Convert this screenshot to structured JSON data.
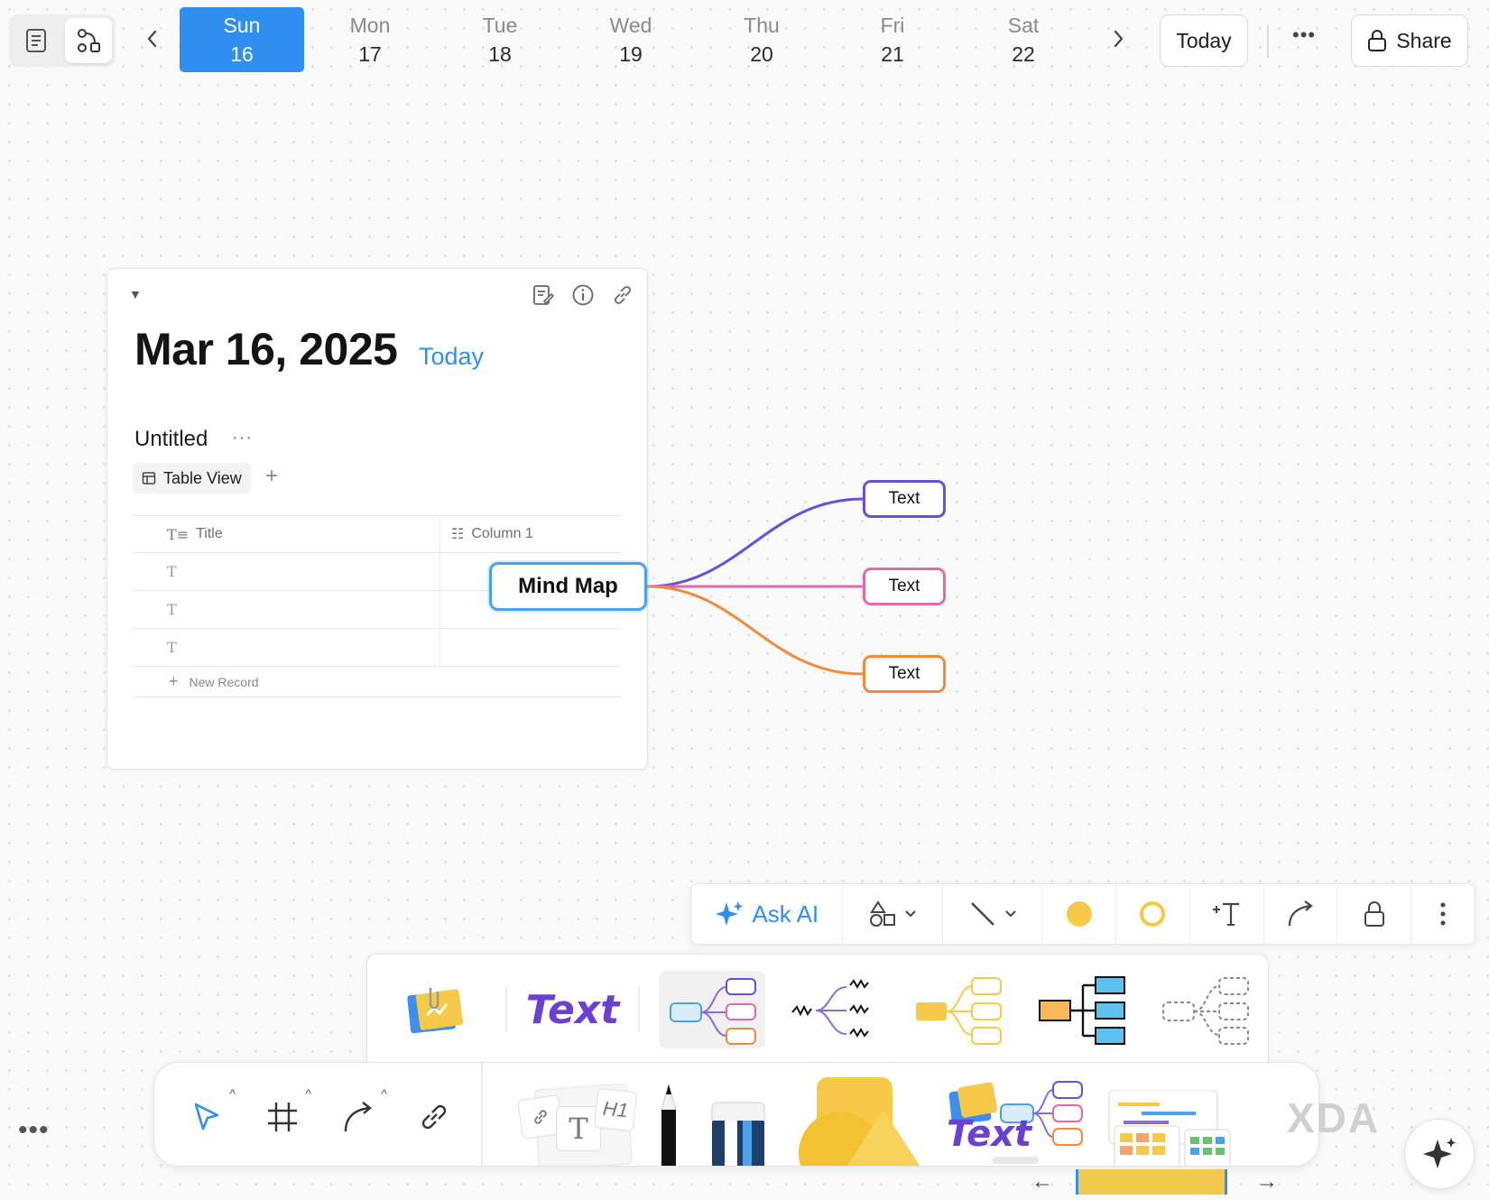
{
  "topbar": {
    "days": [
      {
        "name": "Sun",
        "num": "16"
      },
      {
        "name": "Mon",
        "num": "17"
      },
      {
        "name": "Tue",
        "num": "18"
      },
      {
        "name": "Wed",
        "num": "19"
      },
      {
        "name": "Thu",
        "num": "20"
      },
      {
        "name": "Fri",
        "num": "21"
      },
      {
        "name": "Sat",
        "num": "22"
      }
    ],
    "selected_day": "Sun",
    "today_label": "Today",
    "share_label": "Share",
    "more_label": "•••"
  },
  "journal": {
    "date": "Mar 16, 2025",
    "today_tag": "Today",
    "database": {
      "title": "Untitled",
      "more": "···",
      "view_tab": "Table View",
      "add_view": "+",
      "columns": [
        "Title",
        "Column 1"
      ],
      "row_icon": "T",
      "new_record": "New Record"
    }
  },
  "mindmap": {
    "root": "Mind Map",
    "children": [
      {
        "label": "Text",
        "color": "#6b4fd8"
      },
      {
        "label": "Text",
        "color": "#e26aa9"
      },
      {
        "label": "Text",
        "color": "#f08a3c"
      }
    ],
    "root_color": "#4aa3ea"
  },
  "format_toolbar": {
    "ask_ai": "Ask AI",
    "fill_color": "#f7c948",
    "stroke_color": "#f7c948",
    "accent": "#2f8ff0"
  },
  "templates": {
    "text_label": "Text"
  },
  "dock": {
    "text_label": "Text",
    "h1_label": "H1",
    "t_label": "T"
  },
  "watermark": "XDA",
  "colors": {
    "accent": "#2f8ff0",
    "purple": "#6b3fd1",
    "yellow": "#f7c948"
  }
}
